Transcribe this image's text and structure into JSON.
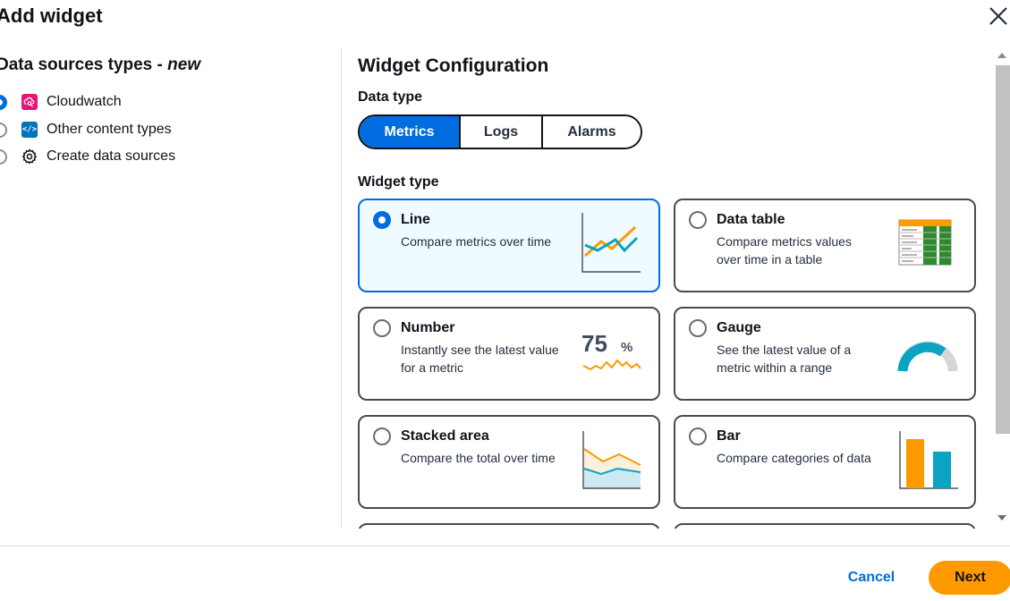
{
  "modal": {
    "title": "Add widget",
    "cancel_label": "Cancel",
    "next_label": "Next"
  },
  "data_sources": {
    "title": "Data sources types - ",
    "title_tag": "new",
    "items": [
      {
        "label": "Cloudwatch",
        "selected": true,
        "icon": "cloudwatch-icon"
      },
      {
        "label": "Other content types",
        "selected": false,
        "icon": "code-icon"
      },
      {
        "label": "Create data sources",
        "selected": false,
        "icon": "gear-icon"
      }
    ]
  },
  "config": {
    "title": "Widget Configuration",
    "data_type_label": "Data type",
    "data_types": [
      "Metrics",
      "Logs",
      "Alarms"
    ],
    "selected_data_type": "Metrics",
    "widget_type_label": "Widget type",
    "widgets": [
      {
        "title": "Line",
        "desc": "Compare metrics over time",
        "selected": true
      },
      {
        "title": "Data table",
        "desc": "Compare metrics values over time in a table",
        "selected": false
      },
      {
        "title": "Number",
        "desc": "Instantly see the latest value for a metric",
        "selected": false,
        "illus_value": "75",
        "illus_unit": "%"
      },
      {
        "title": "Gauge",
        "desc": "See the latest value of a metric within a range",
        "selected": false
      },
      {
        "title": "Stacked area",
        "desc": "Compare the total over time",
        "selected": false
      },
      {
        "title": "Bar",
        "desc": "Compare categories of data",
        "selected": false
      }
    ]
  },
  "colors": {
    "accent": "#006ce0",
    "primary_button": "#ff9900",
    "chart_orange": "#ff9900",
    "chart_teal": "#0aa3c2",
    "table_green": "#2d8a2d"
  }
}
